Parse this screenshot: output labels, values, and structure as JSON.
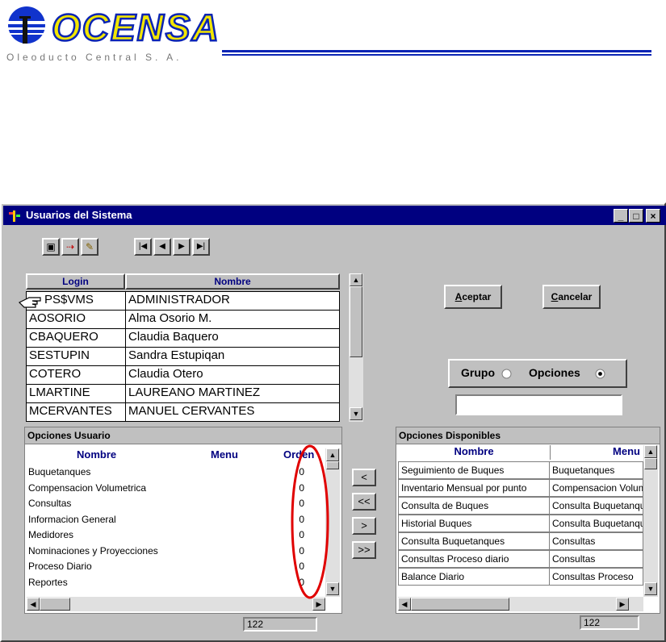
{
  "logo": {
    "brand": "OCENSA",
    "subtitle": "Oleoducto Central S. A."
  },
  "window": {
    "title": "Usuarios del Sistema",
    "minimize_glyph": "_",
    "maximize_glyph": "□",
    "close_glyph": "×"
  },
  "toolbar": {
    "save_glyph": "▣",
    "insert_glyph": "⇢",
    "delete_glyph": "✎",
    "first_glyph": "|◀",
    "prev_glyph": "◀",
    "next_glyph": "▶",
    "last_glyph": "▶|"
  },
  "users_grid": {
    "columns": [
      "Login",
      "Nombre"
    ],
    "rows": [
      {
        "login": "PS$VMS",
        "nombre": "ADMINISTRADOR"
      },
      {
        "login": "AOSORIO",
        "nombre": "Alma Osorio M."
      },
      {
        "login": "CBAQUERO",
        "nombre": "Claudia Baquero"
      },
      {
        "login": "SESTUPIN",
        "nombre": "Sandra Estupiqan"
      },
      {
        "login": "COTERO",
        "nombre": "Claudia Otero"
      },
      {
        "login": "LMARTINE",
        "nombre": "LAUREANO MARTINEZ"
      },
      {
        "login": "MCERVANTES",
        "nombre": "MANUEL CERVANTES"
      }
    ]
  },
  "buttons": {
    "aceptar_first": "A",
    "aceptar_rest": "ceptar",
    "cancelar_first": "C",
    "cancelar_rest": "ancelar"
  },
  "mode": {
    "grupo_label": "Grupo",
    "opciones_label": "Opciones",
    "selected": "Opciones",
    "filter_value": ""
  },
  "opciones_usuario": {
    "title": "Opciones Usuario",
    "columns": [
      "Nombre",
      "Menu",
      "Orden"
    ],
    "rows": [
      {
        "nombre": "Buquetanques",
        "orden": "0"
      },
      {
        "nombre": "Compensacion Volumetrica",
        "orden": "0"
      },
      {
        "nombre": "Consultas",
        "orden": "0"
      },
      {
        "nombre": "Informacion General",
        "orden": "0"
      },
      {
        "nombre": "Medidores",
        "orden": "0"
      },
      {
        "nombre": "Nominaciones y Proyecciones",
        "orden": "0"
      },
      {
        "nombre": "Proceso Diario",
        "orden": "0"
      },
      {
        "nombre": "Reportes",
        "orden": "0"
      }
    ],
    "count": "122"
  },
  "transfer_buttons": [
    "<",
    "<<",
    ">",
    ">>"
  ],
  "opciones_disponibles": {
    "title": "Opciones Disponibles",
    "columns": [
      "Nombre",
      "Menu"
    ],
    "rows": [
      {
        "nombre": "Seguimiento de Buques",
        "menu": "Buquetanques"
      },
      {
        "nombre": "Inventario Mensual por punto",
        "menu": "Compensacion Volumetrica"
      },
      {
        "nombre": "Consulta de Buques",
        "menu": "Consulta Buquetanques"
      },
      {
        "nombre": "Historial Buques",
        "menu": "Consulta Buquetanques"
      },
      {
        "nombre": "Consulta Buquetanques",
        "menu": "Consultas"
      },
      {
        "nombre": "Consultas Proceso diario",
        "menu": "Consultas"
      },
      {
        "nombre": "Balance Diario",
        "menu": "Consultas Proceso"
      }
    ],
    "count": "122"
  },
  "colors": {
    "title_bar": "#000080",
    "header_text": "#000080",
    "annotation_ellipse": "#e00000",
    "logo_blue": "#0a24b4",
    "logo_yellow": "#f2e600"
  }
}
